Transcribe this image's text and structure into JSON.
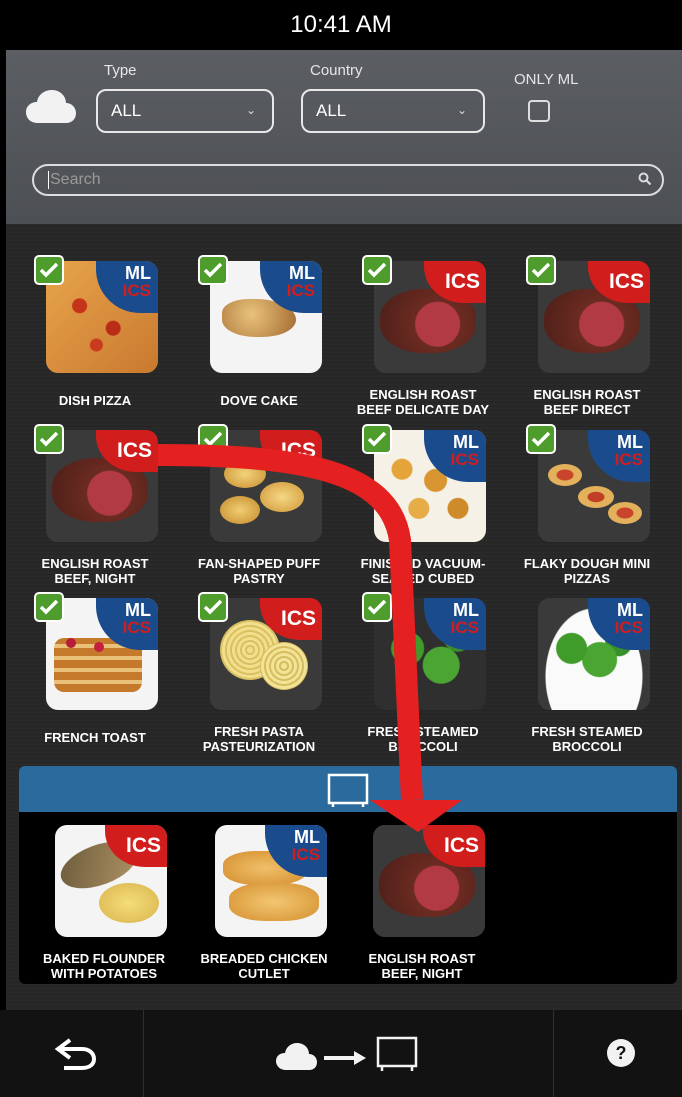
{
  "status": {
    "time": "10:41 AM"
  },
  "filters": {
    "type_label": "Type",
    "type_value": "ALL",
    "country_label": "Country",
    "country_value": "ALL",
    "only_ml_label": "ONLY ML",
    "search_placeholder": "Search"
  },
  "recipes": [
    {
      "name_l1": "DISH PIZZA",
      "name_l2": "",
      "badge": "ML ICS",
      "checked": true
    },
    {
      "name_l1": "DOVE CAKE",
      "name_l2": "",
      "badge": "ML ICS",
      "checked": true
    },
    {
      "name_l1": "ENGLISH ROAST",
      "name_l2": "BEEF DELICATE DAY",
      "badge": "ICS",
      "checked": true
    },
    {
      "name_l1": "ENGLISH ROAST",
      "name_l2": "BEEF DIRECT",
      "badge": "ICS",
      "checked": true
    },
    {
      "name_l1": "ENGLISH ROAST",
      "name_l2": "BEEF, NIGHT",
      "badge": "ICS",
      "checked": true
    },
    {
      "name_l1": "FAN-SHAPED PUFF",
      "name_l2": "PASTRY",
      "badge": "ICS",
      "checked": true
    },
    {
      "name_l1": "FINISHED VACUUM-",
      "name_l2": "SEALED CUBED",
      "badge": "ML ICS",
      "checked": true
    },
    {
      "name_l1": "FLAKY DOUGH MINI",
      "name_l2": "PIZZAS",
      "badge": "ML ICS",
      "checked": true
    },
    {
      "name_l1": "FRENCH TOAST",
      "name_l2": "",
      "badge": "ML ICS",
      "checked": true
    },
    {
      "name_l1": "FRESH PASTA",
      "name_l2": "PASTEURIZATION",
      "badge": "ICS",
      "checked": true
    },
    {
      "name_l1": "FRESH STEAMED",
      "name_l2": "BROCCOLI",
      "badge": "ML ICS",
      "checked": true
    },
    {
      "name_l1": "FRESH STEAMED",
      "name_l2": "BROCCOLI",
      "badge": "ML ICS",
      "checked": false
    }
  ],
  "tray_items": [
    {
      "name_l1": "BAKED FLOUNDER",
      "name_l2": "WITH POTATOES",
      "badge": "ICS"
    },
    {
      "name_l1": "BREADED CHICKEN",
      "name_l2": "CUTLET",
      "badge": "ML ICS"
    },
    {
      "name_l1": "ENGLISH ROAST",
      "name_l2": "BEEF, NIGHT",
      "badge": "ICS"
    }
  ],
  "badge_text": {
    "ml": "ML",
    "ics": "ICS"
  },
  "icons": {
    "cloud": "cloud-icon",
    "chevron": "chevron-down-icon",
    "search": "search-icon",
    "device": "oven-device-icon",
    "back": "back-icon",
    "help": "help-icon",
    "sync": "cloud-to-device-icon",
    "drag_arrow": "drag-arrow-icon"
  },
  "colors": {
    "check": "#4e9c2b",
    "ics": "#d21d1d",
    "ml": "#1a4b8c",
    "tray_header": "#2a6a9c",
    "arrow": "#e42020"
  }
}
